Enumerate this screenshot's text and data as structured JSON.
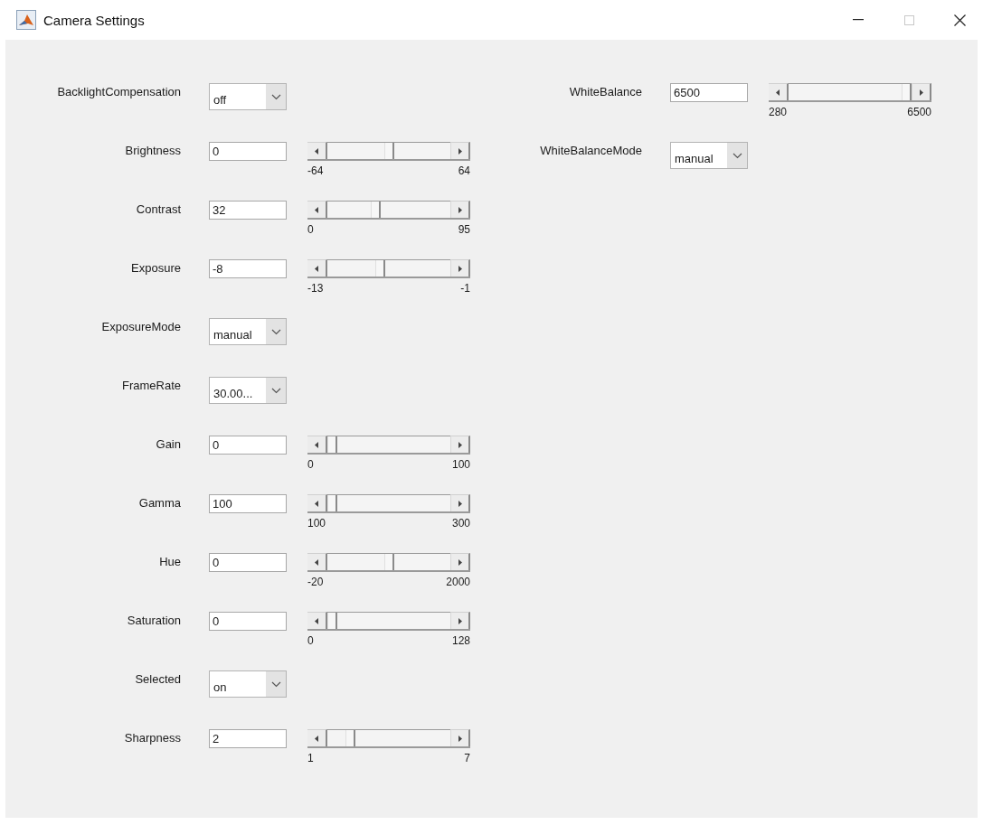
{
  "window": {
    "title": "Camera Settings"
  },
  "columns": [
    {
      "properties": [
        {
          "kind": "dropdown",
          "label": "BacklightCompensation",
          "value": "off"
        },
        {
          "kind": "slider",
          "label": "Brightness",
          "value": "0",
          "min": "-64",
          "max": "64",
          "level": 0.5
        },
        {
          "kind": "slider",
          "label": "Contrast",
          "value": "32",
          "min": "0",
          "max": "95",
          "level": 0.38
        },
        {
          "kind": "slider",
          "label": "Exposure",
          "value": "-8",
          "min": "-13",
          "max": "-1",
          "level": 0.42
        },
        {
          "kind": "dropdown",
          "label": "ExposureMode",
          "value": "manual"
        },
        {
          "kind": "dropdown",
          "label": "FrameRate",
          "value": "30.00..."
        },
        {
          "kind": "slider",
          "label": "Gain",
          "value": "0",
          "min": "0",
          "max": "100",
          "level": 0
        },
        {
          "kind": "slider",
          "label": "Gamma",
          "value": "100",
          "min": "100",
          "max": "300",
          "level": 0
        },
        {
          "kind": "slider",
          "label": "Hue",
          "value": "0",
          "min": "-20",
          "max": "2000",
          "level": 0.5
        },
        {
          "kind": "slider",
          "label": "Saturation",
          "value": "0",
          "min": "0",
          "max": "128",
          "level": 0
        },
        {
          "kind": "dropdown",
          "label": "Selected",
          "value": "on"
        },
        {
          "kind": "slider",
          "label": "Sharpness",
          "value": "2",
          "min": "1",
          "max": "7",
          "level": 0.16
        }
      ]
    },
    {
      "properties": [
        {
          "kind": "slider",
          "label": "WhiteBalance",
          "value": "6500",
          "min": "280",
          "max": "6500",
          "level": 1
        },
        {
          "kind": "dropdown",
          "label": "WhiteBalanceMode",
          "value": "manual"
        }
      ]
    }
  ]
}
